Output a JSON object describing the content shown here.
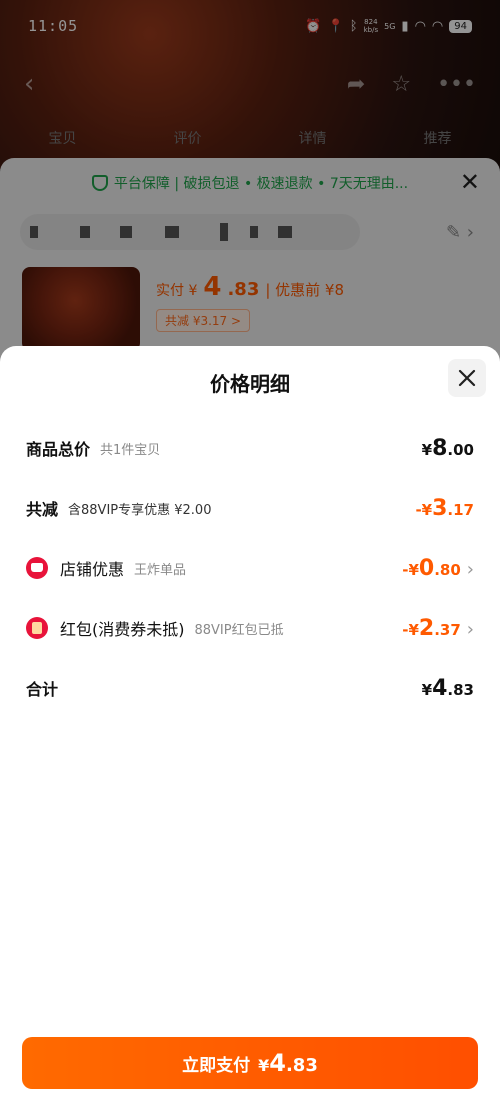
{
  "status_bar": {
    "time": "11:05",
    "speed": "824",
    "speed_unit": "kb/s",
    "network": "5G",
    "battery": "94"
  },
  "background": {
    "tabs": [
      "宝贝",
      "评价",
      "详情",
      "推荐"
    ],
    "guarantee_text": "平台保障 | 破损包退 • 极速退款 • 7天无理由...",
    "price_prefix": "实付 ¥",
    "price_int": "4",
    "price_dec": ".83",
    "price_before": "| 优惠前 ¥8",
    "reduce_chip": "共减 ¥3.17 >"
  },
  "modal": {
    "title": "价格明细",
    "rows": [
      {
        "label": "商品总价",
        "sub": "共1件宝贝",
        "sym": "¥",
        "int": "8",
        "dec": ".00"
      },
      {
        "label": "共减",
        "sub": "含88VIP专享优惠 ¥2.00",
        "sym": "-¥",
        "int": "3",
        "dec": ".17"
      },
      {
        "label": "店铺优惠",
        "sub": "王炸单品",
        "sym": "-¥",
        "int": "0",
        "dec": ".80"
      },
      {
        "label": "红包(消费券未抵)",
        "sub": "88VIP红包已抵",
        "sym": "-¥",
        "int": "2",
        "dec": ".37"
      },
      {
        "label": "合计",
        "sub": "",
        "sym": "¥",
        "int": "4",
        "dec": ".83"
      }
    ]
  },
  "pay_button": {
    "label": "立即支付",
    "sym": "¥",
    "int": "4",
    "dec": ".83"
  },
  "colors": {
    "accent": "#ff5a00",
    "guarantee_green": "#1fa24a",
    "coupon_red": "#e8133a"
  }
}
